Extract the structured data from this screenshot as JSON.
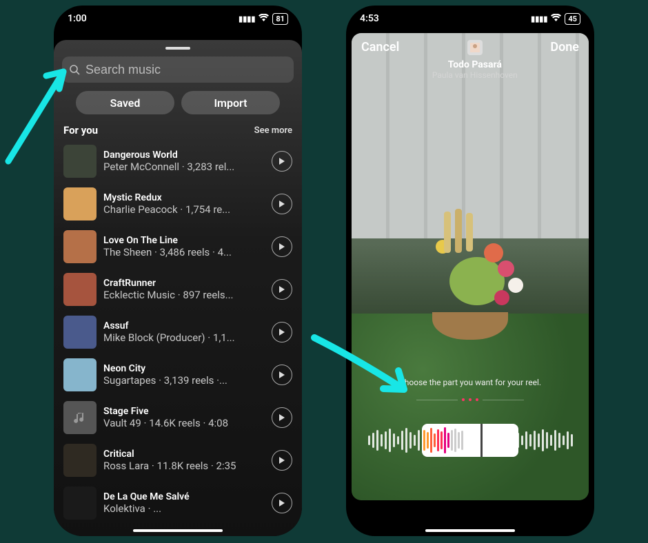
{
  "left": {
    "status": {
      "time": "1:00",
      "battery": "81"
    },
    "search": {
      "placeholder": "Search music"
    },
    "tabs": {
      "saved": "Saved",
      "import": "Import"
    },
    "section": {
      "title": "For you",
      "more": "See more"
    },
    "tracks": [
      {
        "title": "Dangerous World",
        "sub": "Peter McConnell · 3,283 rel..."
      },
      {
        "title": "Mystic Redux",
        "sub": "Charlie Peacock · 1,754 re..."
      },
      {
        "title": "Love On The Line",
        "sub": "The Sheen · 3,486 reels · 4..."
      },
      {
        "title": "CraftRunner",
        "sub": "Ecklectic Music · 897 reels..."
      },
      {
        "title": "Assuf",
        "sub": "Mike Block (Producer) · 1,1..."
      },
      {
        "title": "Neon City",
        "sub": "Sugartapes · 3,139 reels ·..."
      },
      {
        "title": "Stage Five",
        "sub": "Vault 49 · 14.6K reels · 4:08"
      },
      {
        "title": "Critical",
        "sub": "Ross Lara · 11.8K reels · 2:35"
      },
      {
        "title": "De La Que Me Salvé",
        "sub": "Kolektiva · ..."
      }
    ]
  },
  "right": {
    "status": {
      "time": "4:53",
      "battery": "45"
    },
    "cancel": "Cancel",
    "done": "Done",
    "song": {
      "title": "Todo Pasará",
      "artist": "Paula van Hissenhoven"
    },
    "hint": "Choose the part you want for your reel."
  }
}
